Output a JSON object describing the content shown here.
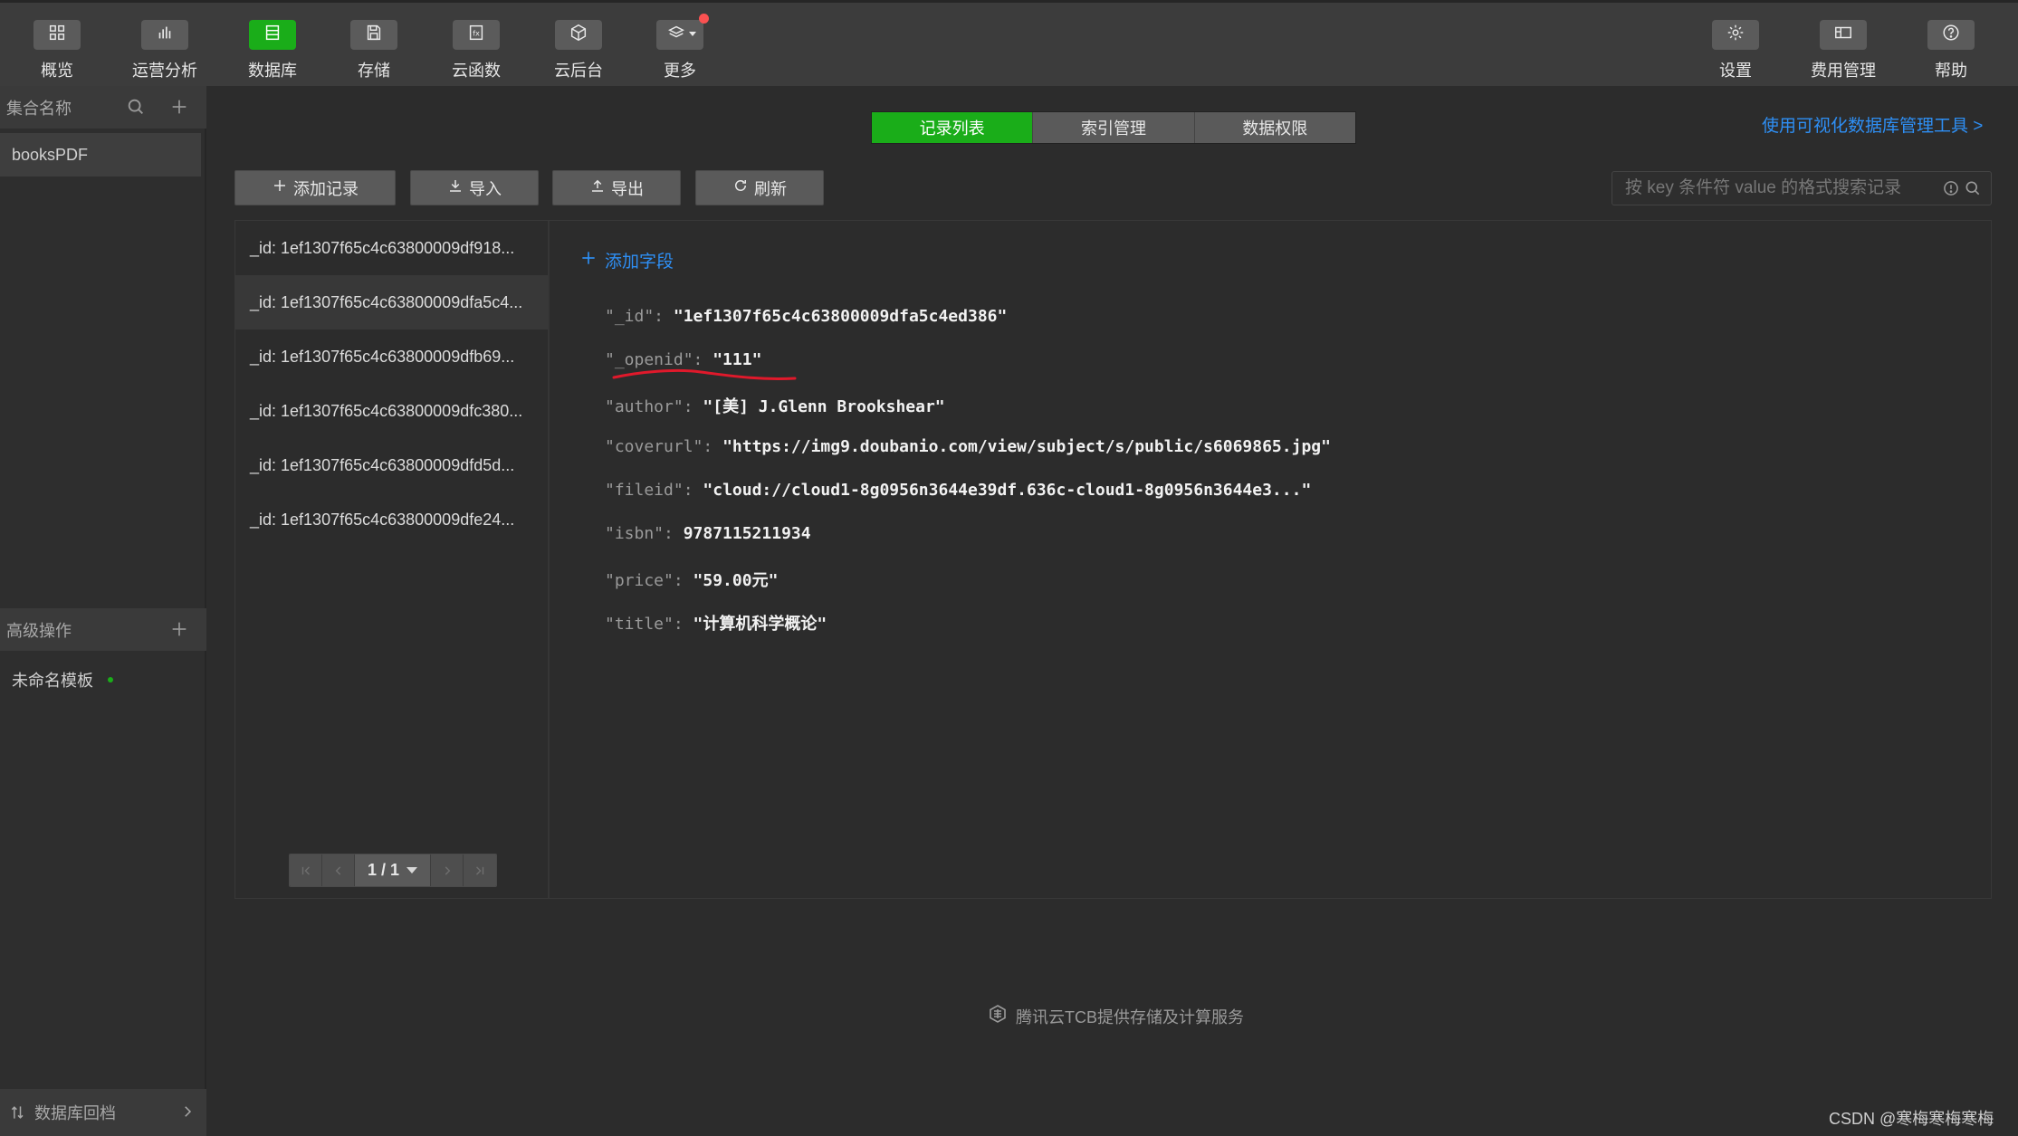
{
  "toolbar": {
    "items": [
      {
        "label": "概览",
        "icon": "overview-icon"
      },
      {
        "label": "运营分析",
        "icon": "analytics-icon"
      },
      {
        "label": "数据库",
        "icon": "database-icon"
      },
      {
        "label": "存储",
        "icon": "storage-icon"
      },
      {
        "label": "云函数",
        "icon": "cloud-function-icon"
      },
      {
        "label": "云后台",
        "icon": "cloud-backend-icon"
      },
      {
        "label": "更多",
        "icon": "layers-icon"
      }
    ],
    "right_items": [
      {
        "label": "设置",
        "icon": "gear-icon"
      },
      {
        "label": "费用管理",
        "icon": "billing-icon"
      },
      {
        "label": "帮助",
        "icon": "help-icon"
      }
    ]
  },
  "sidebar": {
    "collections_header": "集合名称",
    "collections": [
      "booksPDF"
    ],
    "advanced_header": "高级操作",
    "templates": [
      "未命名模板"
    ],
    "rollback": "数据库回档"
  },
  "tabs": [
    "记录列表",
    "索引管理",
    "数据权限"
  ],
  "visual_tool_link": "使用可视化数据库管理工具 >",
  "actions": {
    "add": "添加记录",
    "import": "导入",
    "export": "导出",
    "refresh": "刷新",
    "search_placeholder": "按 key 条件符 value 的格式搜索记录"
  },
  "records": [
    "_id: 1ef1307f65c4c63800009df918...",
    "_id: 1ef1307f65c4c63800009dfa5c4...",
    "_id: 1ef1307f65c4c63800009dfb69...",
    "_id: 1ef1307f65c4c63800009dfc380...",
    "_id: 1ef1307f65c4c63800009dfd5d...",
    "_id: 1ef1307f65c4c63800009dfe24..."
  ],
  "pager": {
    "text": "1 / 1"
  },
  "detail": {
    "add_field": "添加字段",
    "fields": [
      {
        "key": "\"_id\":",
        "value": "\"1ef1307f65c4c63800009dfa5c4ed386\""
      },
      {
        "key": "\"_openid\":",
        "value": "\"111\""
      },
      {
        "key": "\"author\":",
        "value": "\"[美] J.Glenn Brookshear\""
      },
      {
        "key": "\"coverurl\":",
        "value": "\"https://img9.doubanio.com/view/subject/s/public/s6069865.jpg\""
      },
      {
        "key": "\"fileid\":",
        "value": "\"cloud://cloud1-8g0956n3644e39df.636c-cloud1-8g0956n3644e3...\""
      },
      {
        "key": "\"isbn\":",
        "value": "9787115211934"
      },
      {
        "key": "\"price\":",
        "value": "\"59.00元\""
      },
      {
        "key": "\"title\":",
        "value": "\"计算机科学概论\""
      }
    ]
  },
  "footer": {
    "brand": "腾讯云TCB提供存储及计算服务"
  },
  "watermark": "CSDN @寒梅寒梅寒梅",
  "colors": {
    "accent": "#1aad19",
    "link": "#2e8ff5",
    "annotation": "#e0192b"
  }
}
